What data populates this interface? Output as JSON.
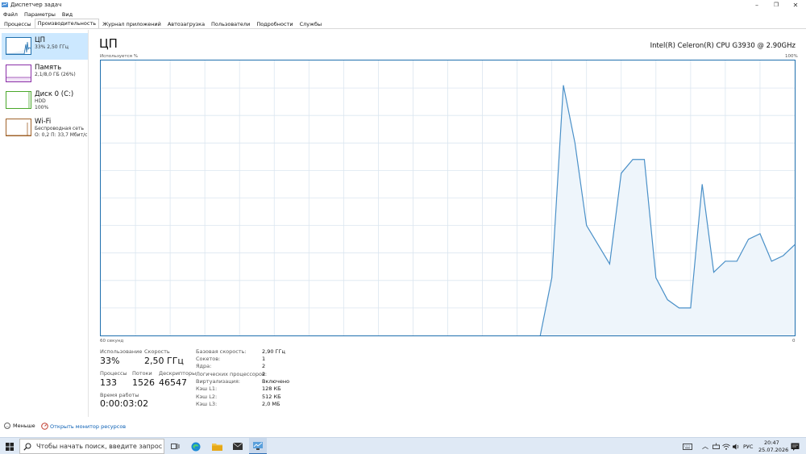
{
  "window": {
    "title": "Диспетчер задач"
  },
  "menu": [
    "Файл",
    "Параметры",
    "Вид"
  ],
  "tabs": [
    {
      "label": "Процессы",
      "active": false
    },
    {
      "label": "Производительность",
      "active": true
    },
    {
      "label": "Журнал приложений",
      "active": false
    },
    {
      "label": "Автозагрузка",
      "active": false
    },
    {
      "label": "Пользователи",
      "active": false
    },
    {
      "label": "Подробности",
      "active": false
    },
    {
      "label": "Службы",
      "active": false
    }
  ],
  "sidebar": [
    {
      "name": "ЦП",
      "sub1": "33% 2,50 ГГц",
      "sub2": "",
      "sub3": "",
      "color": "#1f6fae"
    },
    {
      "name": "Память",
      "sub1": "2,1/8,0 ГБ (26%)",
      "sub2": "",
      "sub3": "",
      "color": "#8b2fa8"
    },
    {
      "name": "Диск 0 (C:)",
      "sub1": "HDD",
      "sub2": "100%",
      "sub3": "",
      "color": "#4aa72a"
    },
    {
      "name": "Wi-Fi",
      "sub1": "Беспроводная сеть",
      "sub2": "О: 0,2 П: 33,7 Мбит/с",
      "sub3": "",
      "color": "#a0622a"
    }
  ],
  "main": {
    "title": "ЦП",
    "cpu_model": "Intel(R) Celeron(R) CPU G3930 @ 2.90GHz",
    "usage_label": "Используется %",
    "max_label": "100%",
    "time_label": "60 секунд",
    "zero_label": "0"
  },
  "stats": {
    "usage_label": "Использование",
    "usage_value": "33%",
    "speed_label": "Скорость",
    "speed_value": "2,50 ГГц",
    "proc_label": "Процессы",
    "proc_value": "133",
    "threads_label": "Потоки",
    "threads_value": "1526",
    "handles_label": "Дескрипторы",
    "handles_value": "46547",
    "uptime_label": "Время работы",
    "uptime_value": "0:00:03:02"
  },
  "details": [
    {
      "label": "Базовая скорость:",
      "value": "2,90 ГГц"
    },
    {
      "label": "Сокетов:",
      "value": "1"
    },
    {
      "label": "Ядра:",
      "value": "2"
    },
    {
      "label": "Логических процессоров:",
      "value": "2"
    },
    {
      "label": "Виртуализация:",
      "value": "Включено"
    },
    {
      "label": "Кэш L1:",
      "value": "128 КБ"
    },
    {
      "label": "Кэш L2:",
      "value": "512 КБ"
    },
    {
      "label": "Кэш L3:",
      "value": "2,0 МБ"
    }
  ],
  "footer": {
    "less": "Меньше",
    "monitor": "Открыть монитор ресурсов"
  },
  "taskbar": {
    "search_placeholder": "Чтобы начать поиск, введите запрос",
    "lang": "РУС",
    "time": "20:47",
    "date": "25.07.2026"
  },
  "chart_data": {
    "type": "area",
    "x": [
      0,
      1,
      2,
      3,
      4,
      5,
      6,
      7,
      8,
      9,
      10,
      11,
      12,
      13,
      14,
      15,
      16,
      17,
      18,
      19,
      20,
      21,
      22,
      23,
      24,
      25,
      26,
      27,
      28,
      29,
      30,
      31,
      32,
      33,
      34,
      35,
      36,
      37,
      38,
      39,
      40,
      41,
      42,
      43,
      44,
      45,
      46,
      47,
      48,
      49,
      50,
      51,
      52,
      53,
      54,
      55,
      56,
      57,
      58,
      59,
      60
    ],
    "values": [
      0,
      0,
      0,
      0,
      0,
      0,
      0,
      0,
      0,
      0,
      0,
      0,
      0,
      0,
      0,
      0,
      0,
      0,
      0,
      0,
      0,
      0,
      0,
      0,
      0,
      0,
      0,
      0,
      0,
      0,
      0,
      0,
      0,
      0,
      0,
      0,
      0,
      0,
      0,
      21,
      91,
      70,
      40,
      33,
      26,
      59,
      64,
      64,
      21,
      13,
      10,
      10,
      55,
      23,
      27,
      27,
      35,
      37,
      27,
      29,
      33
    ],
    "ylim": [
      0,
      100
    ],
    "grid": true,
    "colors": {
      "line": "#4a90c8",
      "fill": "#eef5fb",
      "grid": "#dbe6f0"
    }
  }
}
